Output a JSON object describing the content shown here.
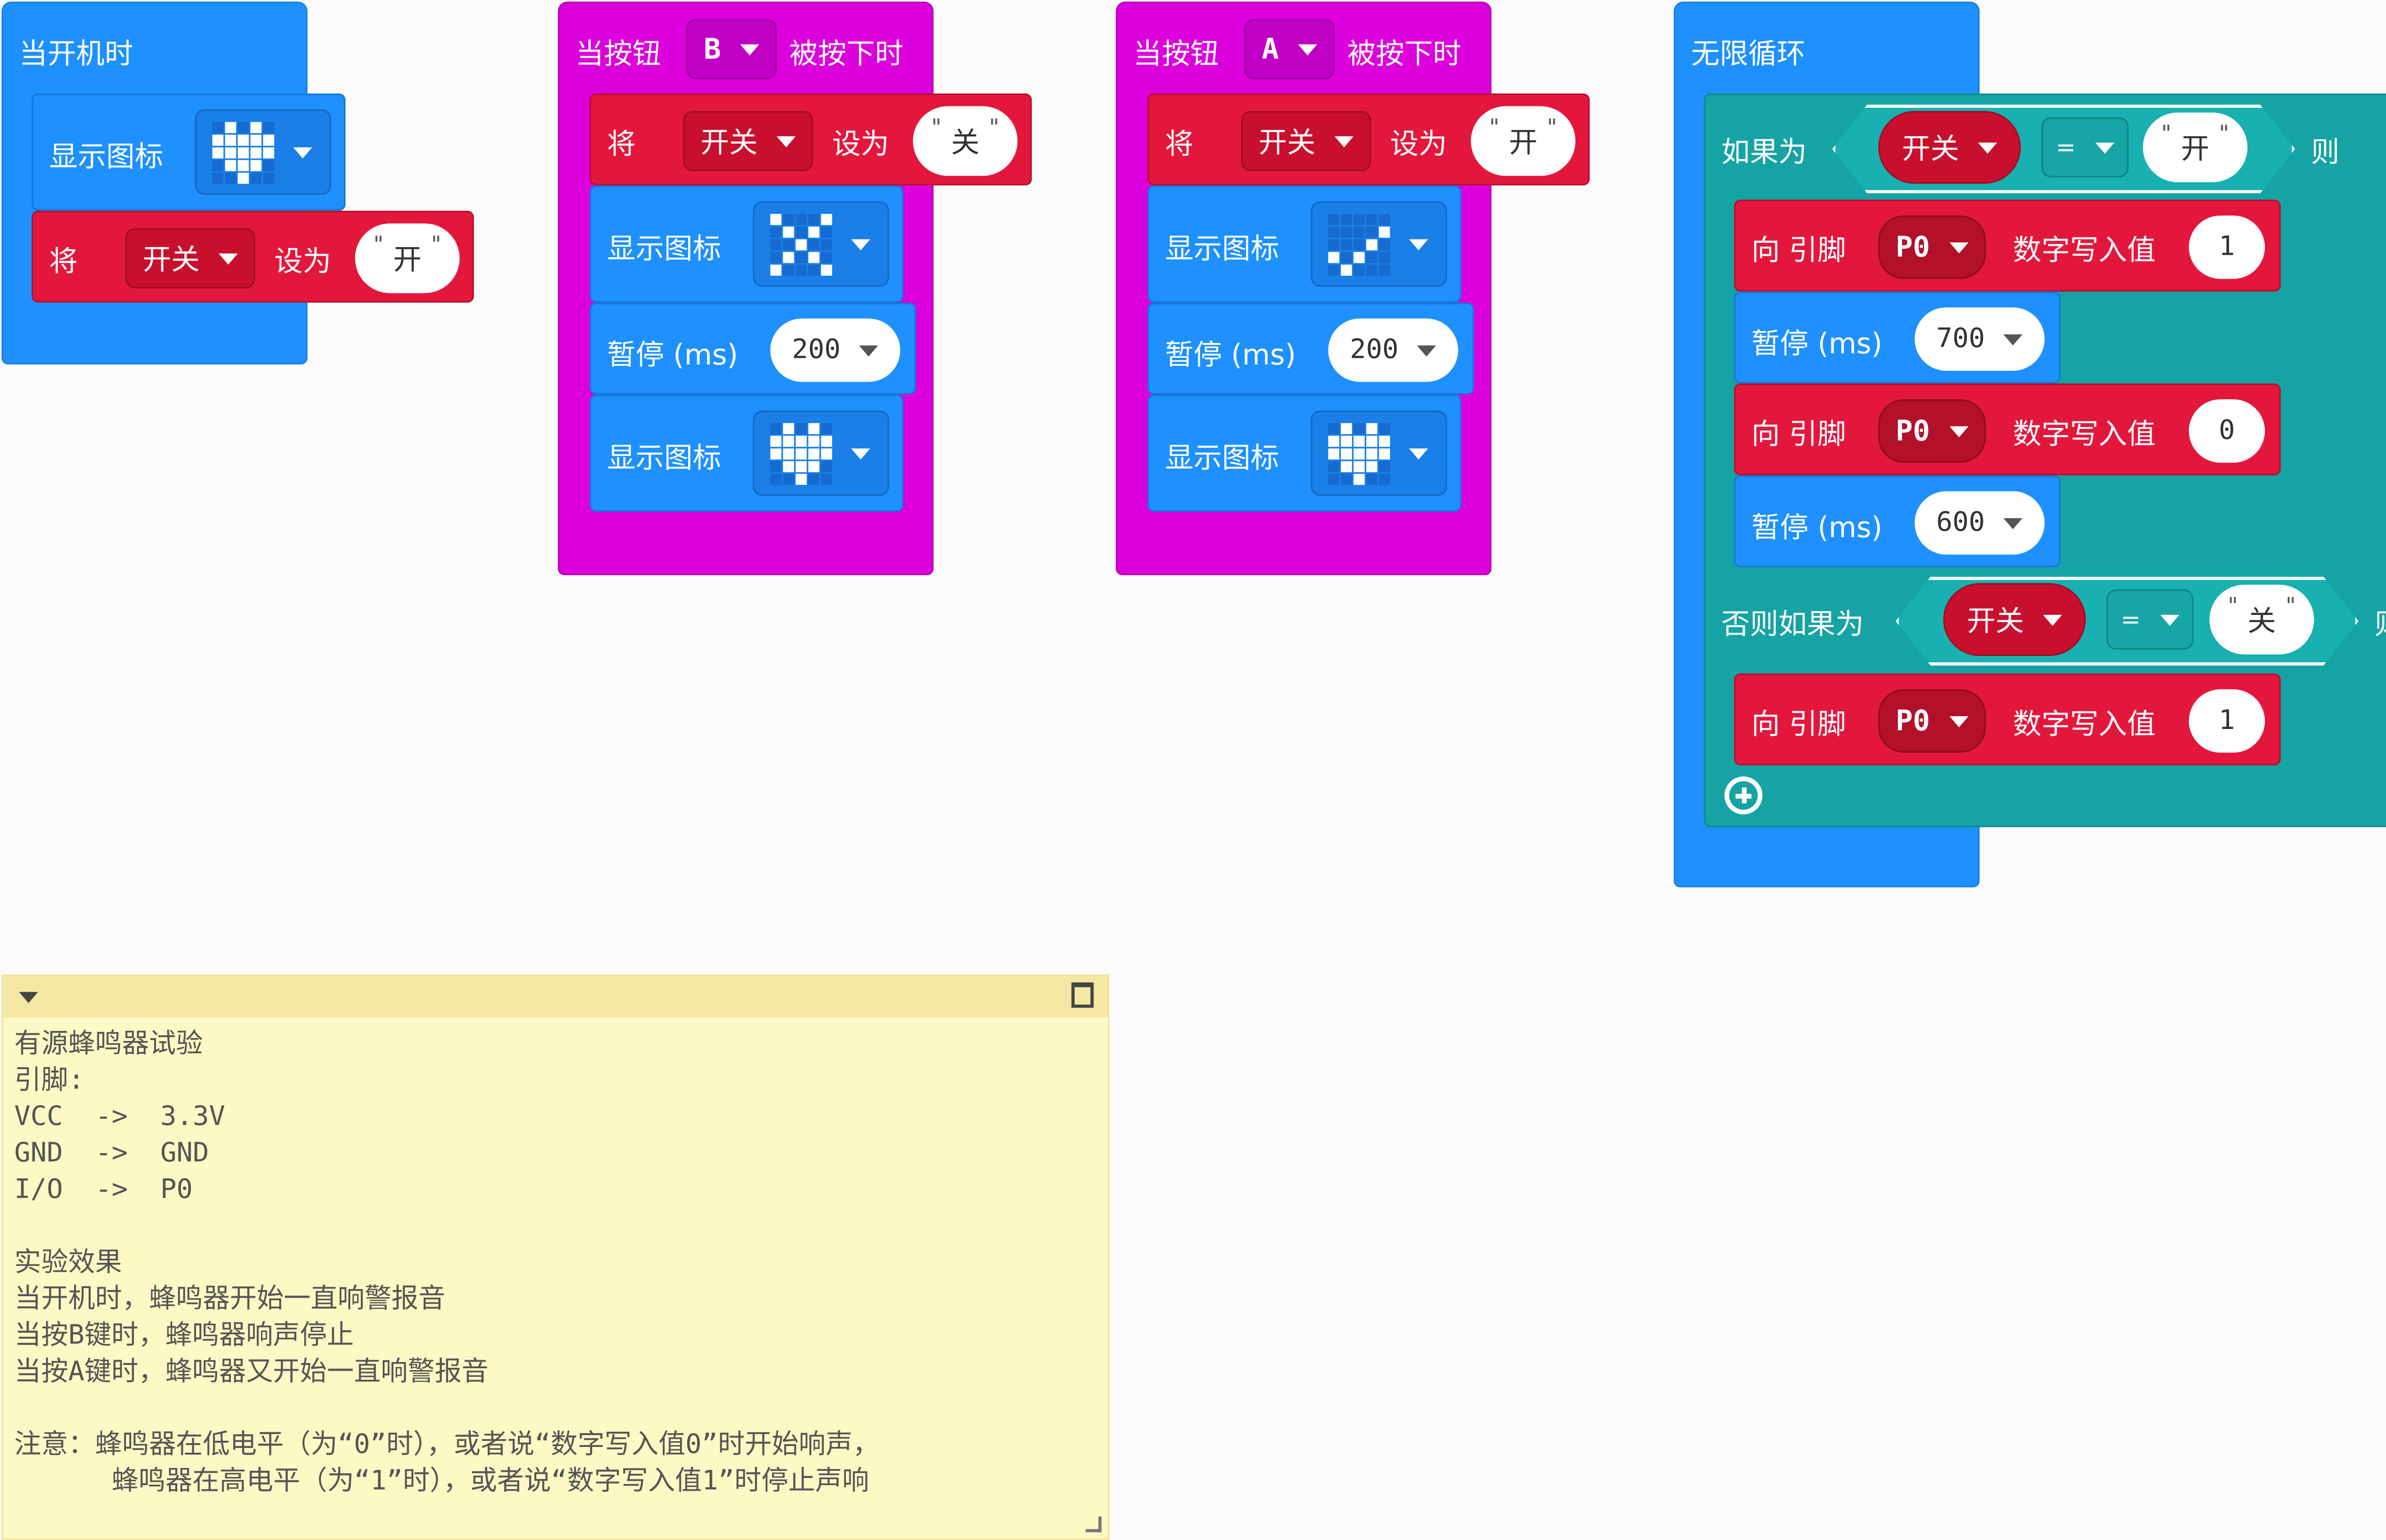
{
  "colors": {
    "events_blue": "#1e90ff",
    "input_magenta": "#dc00dc",
    "logic_teal": "#15a3a3",
    "variables_red": "#e3173c",
    "comment_yellow": "#fdf9c4"
  },
  "icons": {
    "heart": [
      0,
      1,
      0,
      1,
      0,
      1,
      1,
      1,
      1,
      1,
      1,
      1,
      1,
      1,
      1,
      0,
      1,
      1,
      1,
      0,
      0,
      0,
      1,
      0,
      0
    ],
    "x": [
      1,
      0,
      0,
      0,
      1,
      0,
      1,
      0,
      1,
      0,
      0,
      0,
      1,
      0,
      0,
      0,
      1,
      0,
      1,
      0,
      1,
      0,
      0,
      0,
      1
    ],
    "check": [
      0,
      0,
      0,
      0,
      0,
      0,
      0,
      0,
      0,
      1,
      0,
      0,
      0,
      1,
      0,
      1,
      0,
      1,
      0,
      0,
      0,
      1,
      0,
      0,
      0
    ]
  },
  "on_start": {
    "title": "当开机时",
    "show_icon": "显示图标",
    "set_label": "将",
    "variable": "开关",
    "set_to": "设为",
    "value": "开"
  },
  "on_button_b": {
    "prefix": "当按钮",
    "button": "B",
    "suffix": "被按下时",
    "set_label": "将",
    "variable": "开关",
    "set_to": "设为",
    "value": "关",
    "show_icon_1": "显示图标",
    "pause": "暂停 (ms)",
    "pause_value": "200",
    "show_icon_2": "显示图标"
  },
  "on_button_a": {
    "prefix": "当按钮",
    "button": "A",
    "suffix": "被按下时",
    "set_label": "将",
    "variable": "开关",
    "set_to": "设为",
    "value": "开",
    "show_icon_1": "显示图标",
    "pause": "暂停 (ms)",
    "pause_value": "200",
    "show_icon_2": "显示图标"
  },
  "forever": {
    "title": "无限循环",
    "if_label": "如果为",
    "variable": "开关",
    "op": "=",
    "compare_value": "开",
    "then": "则",
    "write1": {
      "prefix": "向 引脚",
      "pin": "P0",
      "label": "数字写入值",
      "value": "1"
    },
    "pause1": {
      "label": "暂停 (ms)",
      "value": "700"
    },
    "write2": {
      "prefix": "向 引脚",
      "pin": "P0",
      "label": "数字写入值",
      "value": "0"
    },
    "pause2": {
      "label": "暂停 (ms)",
      "value": "600"
    },
    "elseif_label": "否则如果为",
    "elseif_variable": "开关",
    "elseif_op": "=",
    "elseif_value": "关",
    "elseif_then": "则",
    "write3": {
      "prefix": "向 引脚",
      "pin": "P0",
      "label": "数字写入值",
      "value": "1"
    }
  },
  "comment": {
    "lines": [
      "有源蜂鸣器试验",
      "引脚:",
      "VCC  ->  3.3V",
      "GND  ->  GND",
      "I/O  ->  P0",
      "",
      "实验效果",
      "当开机时，蜂鸣器开始一直响警报音",
      "当按B键时，蜂鸣器响声停止",
      "当按A键时，蜂鸣器又开始一直响警报音",
      "",
      "注意：蜂鸣器在低电平（为“0”时），或者说“数字写入值0”时开始响声，",
      "      蜂鸣器在高电平（为“1”时），或者说“数字写入值1”时停止声响"
    ]
  }
}
